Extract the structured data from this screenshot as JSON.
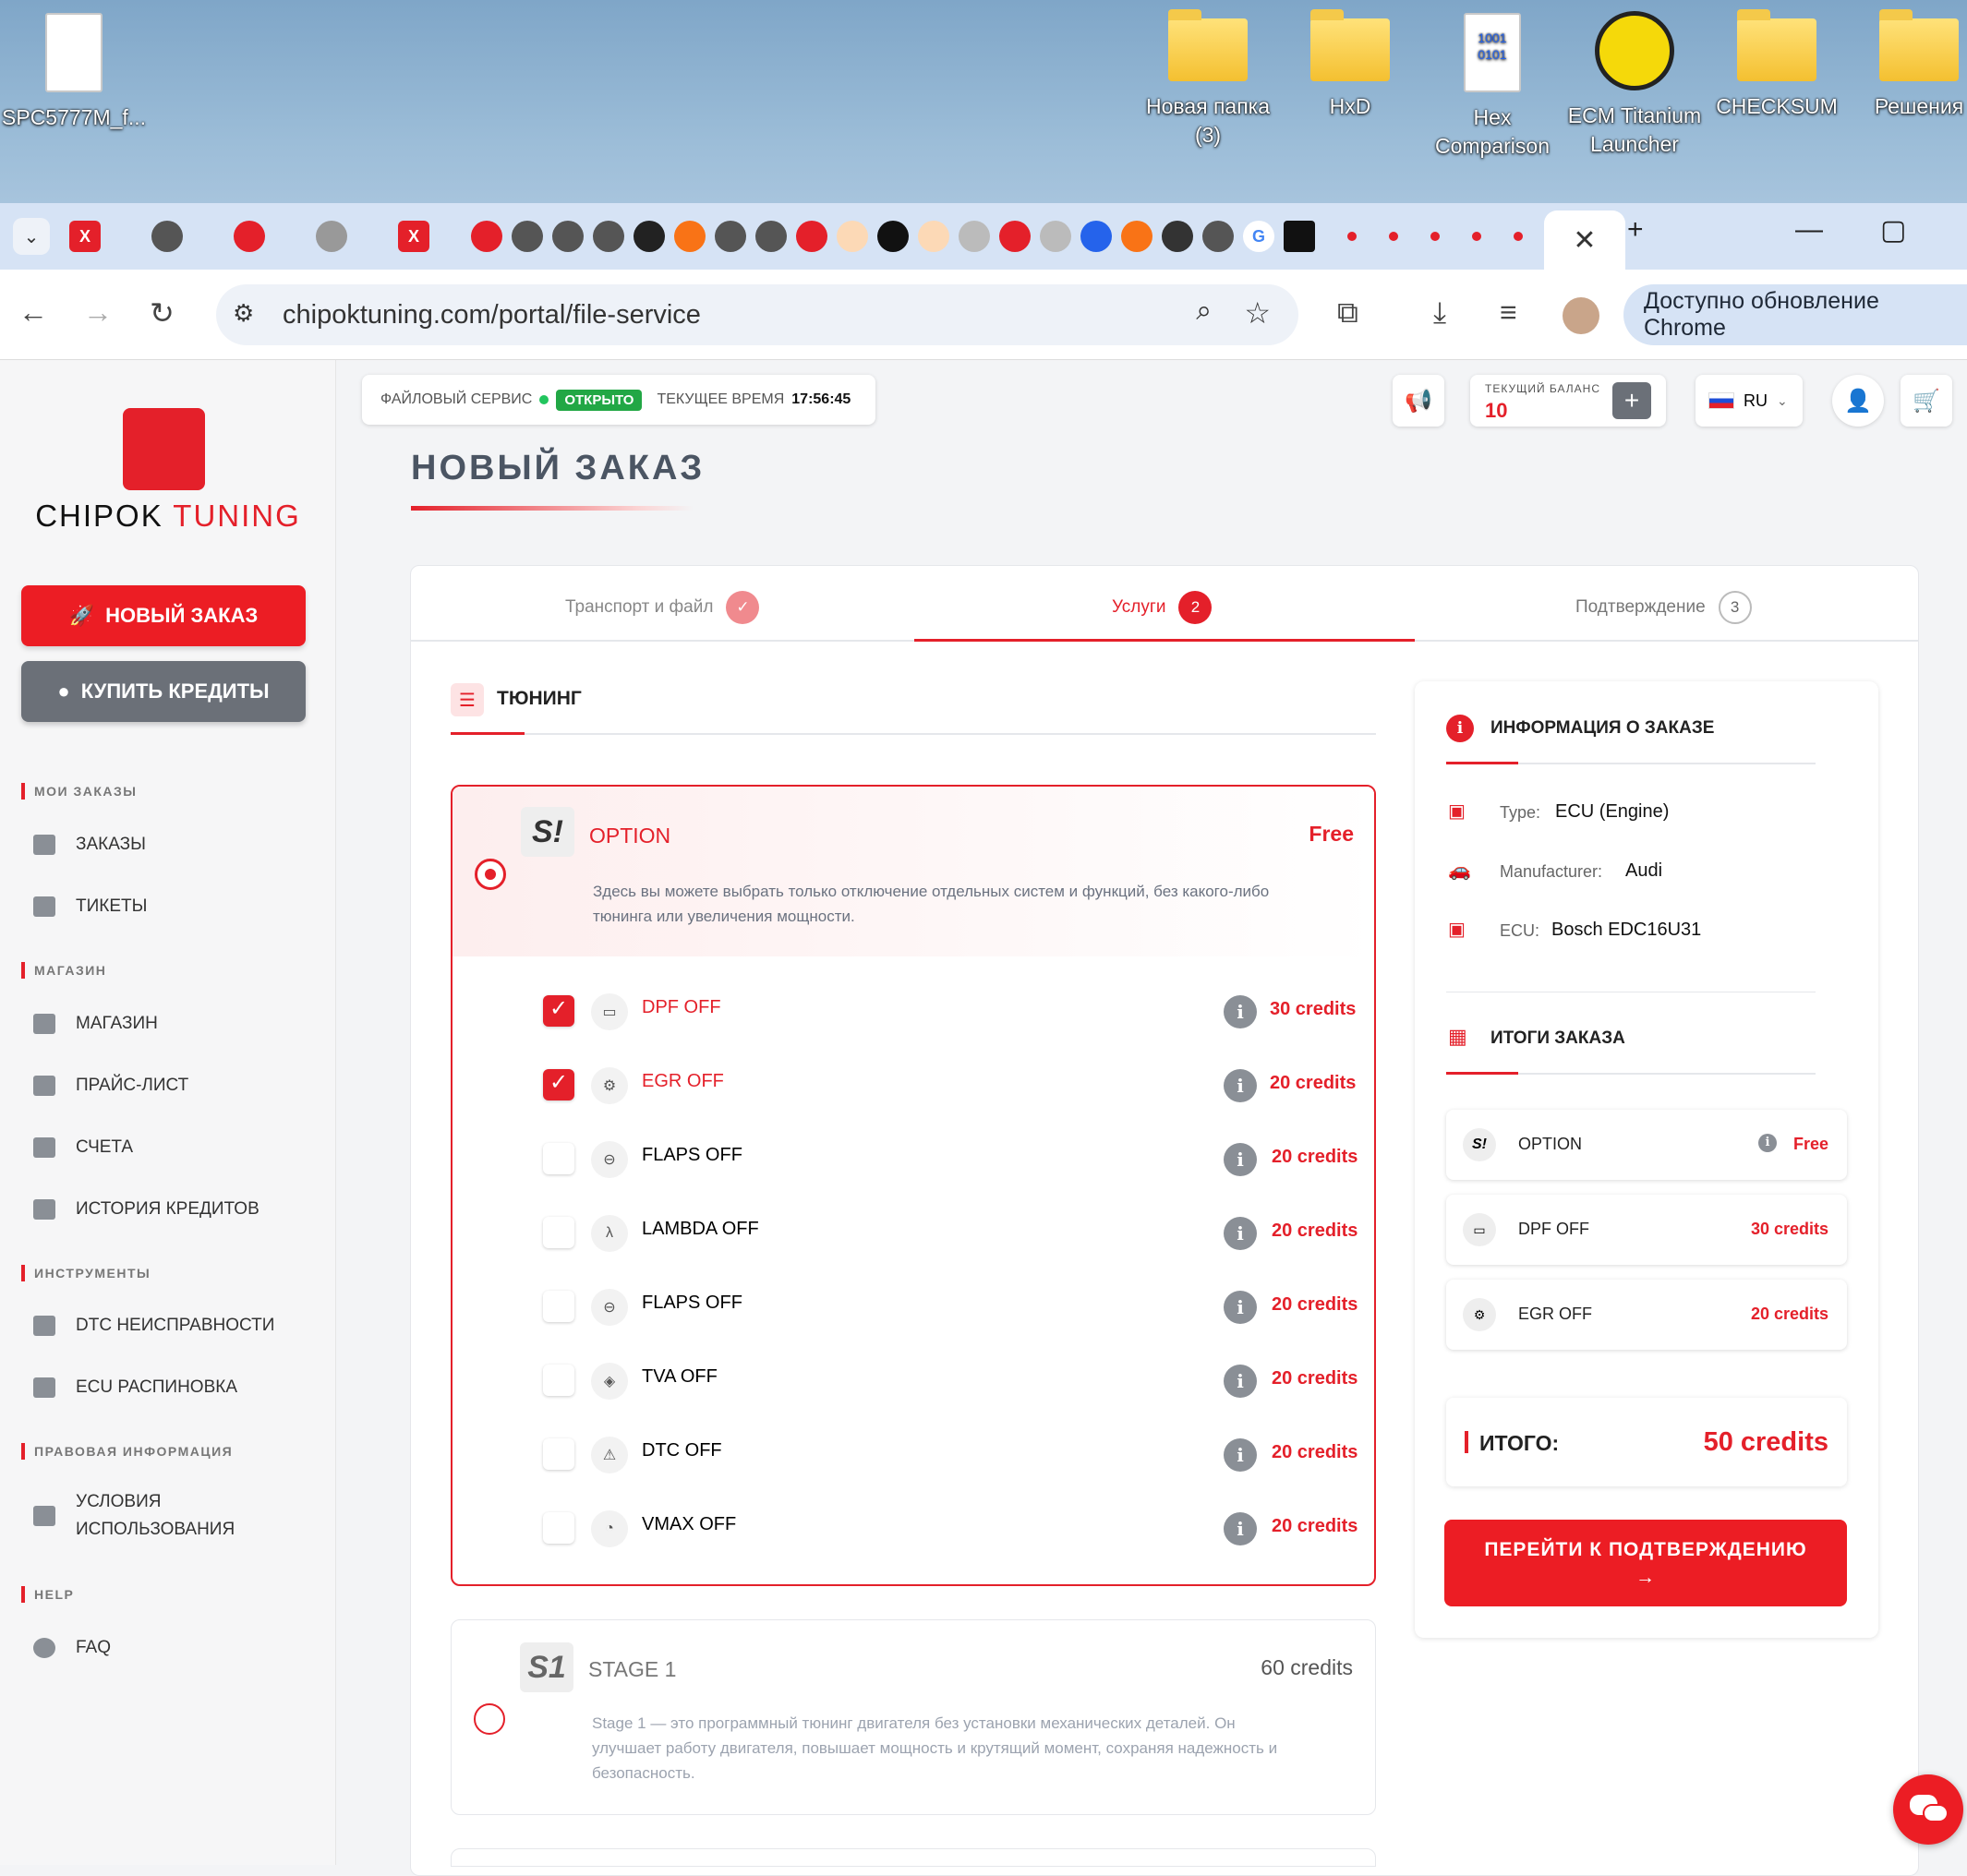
{
  "desktop": {
    "icons": [
      {
        "label": "SPC5777M_f...",
        "type": "file"
      },
      {
        "label": "Новая папка (3)",
        "type": "folder"
      },
      {
        "label": "HxD",
        "type": "folder"
      },
      {
        "label": "Hex Comparison",
        "type": "shortcut"
      },
      {
        "label": "ECM Titanium Launcher",
        "type": "shortcut"
      },
      {
        "label": "CHECKSUM",
        "type": "folder"
      },
      {
        "label": "Решения",
        "type": "folder"
      }
    ]
  },
  "browser": {
    "url": "chipoktuning.com/portal/file-service",
    "update_label": "Доступно обновление Chrome",
    "new_tab": "+"
  },
  "header": {
    "service_label": "ФАЙЛОВЫЙ СЕРВИС",
    "status": "ОТКРЫТО",
    "time_label": "ТЕКУЩЕЕ ВРЕМЯ",
    "time": "17:56:45",
    "balance_label": "ТЕКУЩИЙ БАЛАНС",
    "balance": "10",
    "lang": "RU"
  },
  "sidebar": {
    "brand_a": "CHIPOK",
    "brand_b": "TUNING",
    "new_order": "НОВЫЙ ЗАКАЗ",
    "buy_credits": "КУПИТЬ КРЕДИТЫ",
    "sections": {
      "orders": "МОИ ЗАКАЗЫ",
      "shop": "МАГАЗИН",
      "tools": "ИНСТРУМЕНТЫ",
      "legal": "ПРАВОВАЯ ИНФОРМАЦИЯ",
      "help": "HELP"
    },
    "items": {
      "orders": "ЗАКАЗЫ",
      "tickets": "ТИКЕТЫ",
      "shop": "МАГАЗИН",
      "pricelist": "ПРАЙС-ЛИСТ",
      "invoices": "СЧЕТА",
      "history": "ИСТОРИЯ КРЕДИТОВ",
      "dtc": "DTC НЕИСПРАВНОСТИ",
      "pinout": "ECU РАСПИНОВКА",
      "terms1": "УСЛОВИЯ",
      "terms2": "ИСПОЛЬЗОВАНИЯ",
      "faq": "FAQ"
    }
  },
  "page": {
    "title": "НОВЫЙ ЗАКАЗ",
    "steps": [
      {
        "label": "Транспорт и файл",
        "num": "✓"
      },
      {
        "label": "Услуги",
        "num": "2"
      },
      {
        "label": "Подтверждение",
        "num": "3"
      }
    ],
    "tuning_heading": "ТЮНИНГ",
    "option": {
      "name": "OPTION",
      "price": "Free",
      "desc1": "Здесь вы можете выбрать только отключение отдельных систем и функций, без какого-либо",
      "desc2": "тюнинга или увеличения мощности."
    },
    "options": [
      {
        "label": "DPF OFF",
        "price": "30 credits",
        "checked": true
      },
      {
        "label": "EGR OFF",
        "price": "20 credits",
        "checked": true
      },
      {
        "label": "FLAPS OFF",
        "price": "20 credits",
        "checked": false
      },
      {
        "label": "LAMBDA OFF",
        "price": "20 credits",
        "checked": false
      },
      {
        "label": "FLAPS OFF",
        "price": "20 credits",
        "checked": false
      },
      {
        "label": "TVA OFF",
        "price": "20 credits",
        "checked": false
      },
      {
        "label": "DTC OFF",
        "price": "20 credits",
        "checked": false
      },
      {
        "label": "VMAX OFF",
        "price": "20 credits",
        "checked": false
      }
    ],
    "stage1": {
      "name": "STAGE 1",
      "price": "60 credits",
      "desc1": "Stage 1 — это программный тюнинг двигателя без установки механических деталей. Он",
      "desc2": "улучшает работу двигателя, повышает мощность и крутящий момент, сохраняя надежность и",
      "desc3": "безопасность."
    }
  },
  "order_info": {
    "heading": "ИНФОРМАЦИЯ О ЗАКАЗЕ",
    "type_label": "Type:",
    "type": "ECU (Engine)",
    "man_label": "Manufacturer:",
    "man": "Audi",
    "ecu_label": "ECU:",
    "ecu": "Bosch EDC16U31",
    "summary_heading": "ИТОГИ ЗАКАЗА",
    "summary": [
      {
        "label": "OPTION",
        "price": "Free"
      },
      {
        "label": "DPF OFF",
        "price": "30 credits"
      },
      {
        "label": "EGR OFF",
        "price": "20 credits"
      }
    ],
    "total_label": "ИТОГО:",
    "total": "50 credits",
    "confirm": "ПЕРЕЙТИ К ПОДТВЕРЖДЕНИЮ",
    "confirm_arrow": "→"
  },
  "colors": {
    "accent": "#e4202a",
    "gray": "#6b7078"
  }
}
